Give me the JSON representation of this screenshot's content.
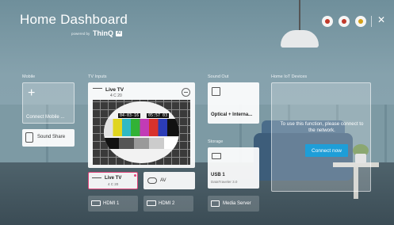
{
  "header": {
    "title": "Home Dashboard",
    "powered_by": "powered by",
    "brand": "ThinQ",
    "brand_badge": "AI"
  },
  "sections": {
    "mobile": "Mobile",
    "tv_inputs": "TV Inputs",
    "sound_out": "Sound Out",
    "storage": "Storage",
    "home_iot": "Home IoT Devices"
  },
  "mobile": {
    "add_label": "Connect Mobile ...",
    "sound_share": "Sound Share"
  },
  "tv": {
    "live_label": "Live TV",
    "live_channel": "4 C 20",
    "testcard_left": "04-03-16",
    "testcard_right": "05:57 03",
    "inputs": [
      {
        "label": "Live TV",
        "channel": "4 C 20"
      },
      {
        "label": "AV"
      },
      {
        "label": "HDMI 1"
      },
      {
        "label": "HDMI 2"
      }
    ]
  },
  "sound_out": {
    "label": "Optical + Interna..."
  },
  "storage": {
    "usb_label": "USB 1",
    "usb_sub": "DataTraveler 3.0",
    "media_server": "Media Server"
  },
  "iot": {
    "message": "To use this function, please connect to the network.",
    "connect_button": "Connect now"
  },
  "colors": {
    "accent": "#1e9ed8",
    "focus": "#e0457b"
  }
}
